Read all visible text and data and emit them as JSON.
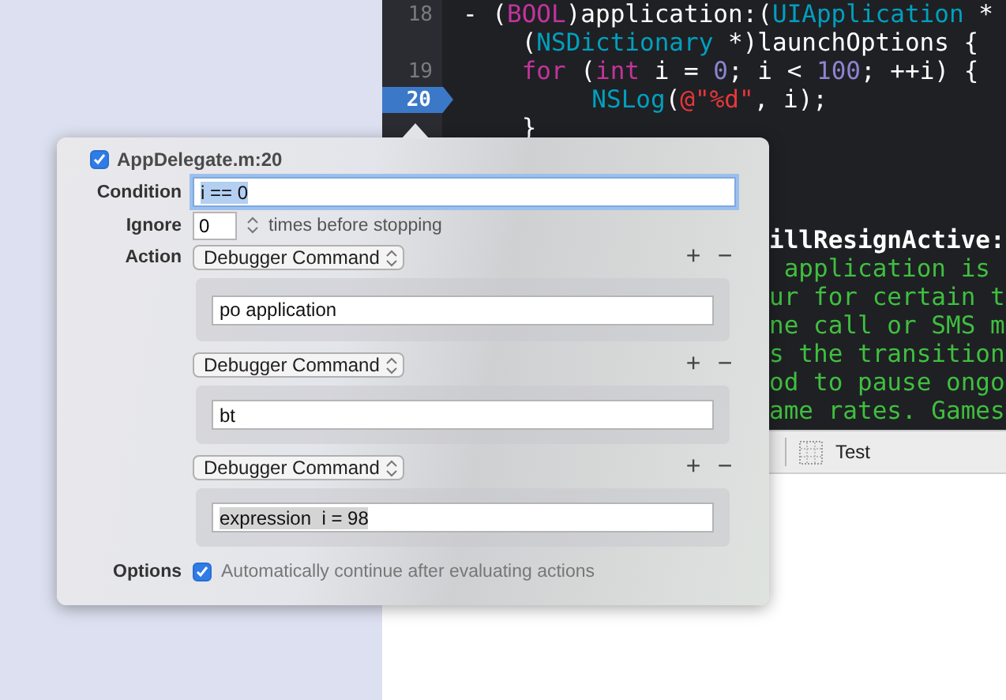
{
  "editor": {
    "lines": [
      {
        "number": "18",
        "breakpoint": false,
        "tokens": [
          {
            "text": "- (",
            "color": "#ffffff"
          },
          {
            "text": "BOOL",
            "color": "#c2349b"
          },
          {
            "text": ")application:(",
            "color": "#ffffff"
          },
          {
            "text": "UIApplication",
            "color": "#00a0be"
          },
          {
            "text": " *",
            "color": "#ffffff"
          }
        ]
      },
      {
        "breakpoint": false,
        "tokens": [
          {
            "text": "    (",
            "color": "#ffffff"
          },
          {
            "text": "NSDictionary",
            "color": "#00a0be"
          },
          {
            "text": " *)launchOptions {",
            "color": "#ffffff"
          }
        ]
      },
      {
        "number": "19",
        "breakpoint": false,
        "tokens": [
          {
            "text": "    for",
            "color": "#c2349b"
          },
          {
            "text": " (",
            "color": "#ffffff"
          },
          {
            "text": "int",
            "color": "#c2349b"
          },
          {
            "text": " i = ",
            "color": "#ffffff"
          },
          {
            "text": "0",
            "color": "#8b84cf"
          },
          {
            "text": "; i < ",
            "color": "#ffffff"
          },
          {
            "text": "100",
            "color": "#8b84cf"
          },
          {
            "text": "; ++i) {",
            "color": "#ffffff"
          }
        ]
      },
      {
        "number": "20",
        "breakpoint": true,
        "tokens": [
          {
            "text": "        NSLog",
            "color": "#00a0be"
          },
          {
            "text": "(",
            "color": "#ffffff"
          },
          {
            "text": "@\"%d\"",
            "color": "#e8373a"
          },
          {
            "text": ", i);",
            "color": "#ffffff"
          }
        ]
      },
      {
        "breakpoint": false,
        "tokens": [
          {
            "text": "    }",
            "color": "#ffffff"
          }
        ]
      }
    ],
    "visible_fragments": [
      {
        "text": "illResignActive:",
        "color": "#ffffff"
      },
      {
        "text": " application is",
        "color": "#3fbf3f"
      },
      {
        "text": "ur for certain t",
        "color": "#3fbf3f"
      },
      {
        "text": "ne call or SMS m",
        "color": "#3fbf3f"
      },
      {
        "text": "s the transition",
        "color": "#3fbf3f"
      },
      {
        "text": "od to pause ongo",
        "color": "#3fbf3f"
      },
      {
        "text": "ame rates. Games",
        "color": "#3fbf3f"
      }
    ]
  },
  "bottom_bar": {
    "label": "Test"
  },
  "popover": {
    "title": "AppDelegate.m:20",
    "enabled": true,
    "condition": {
      "label": "Condition",
      "value": "i == 0"
    },
    "ignore": {
      "label": "Ignore",
      "value": "0",
      "suffix": "times before stopping"
    },
    "action_label": "Action",
    "actions": [
      {
        "type": "Debugger Command",
        "value": "po application",
        "add": "+",
        "remove": "−"
      },
      {
        "type": "Debugger Command",
        "value": "bt",
        "add": "+",
        "remove": "−"
      },
      {
        "type": "Debugger Command",
        "value": "expression  i = 98",
        "add": "+",
        "remove": "−"
      }
    ],
    "options": {
      "label": "Options",
      "text": "Automatically continue after evaluating actions",
      "checked": true
    }
  }
}
